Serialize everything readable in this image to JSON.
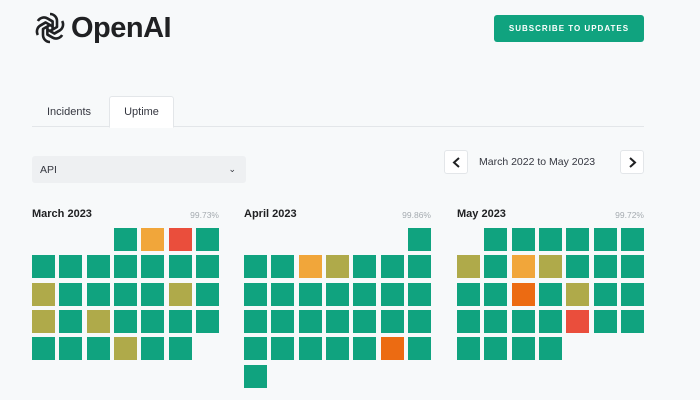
{
  "brand": {
    "name": "OpenAI"
  },
  "header": {
    "subscribe_label": "SUBSCRIBE TO UPDATES"
  },
  "tabs": [
    {
      "label": "Incidents",
      "active": false
    },
    {
      "label": "Uptime",
      "active": true
    }
  ],
  "component_select": {
    "value": "API"
  },
  "date_range": {
    "label": "March 2022 to May 2023"
  },
  "colors": {
    "ok": "#10a37f",
    "minor": "#afaa4a",
    "partial": "#f1a63a",
    "major": "#ec6b12",
    "outage": "#ea4e3c"
  },
  "months": [
    {
      "name": "March 2023",
      "uptime": "99.73%",
      "first_weekday": 3,
      "days": [
        "ok",
        "partial",
        "outage",
        "ok",
        "ok",
        "ok",
        "ok",
        "ok",
        "ok",
        "ok",
        "ok",
        "minor",
        "ok",
        "ok",
        "ok",
        "ok",
        "minor",
        "ok",
        "minor",
        "ok",
        "minor",
        "ok",
        "ok",
        "ok",
        "ok",
        "ok",
        "ok",
        "ok",
        "minor",
        "ok",
        "ok"
      ]
    },
    {
      "name": "April 2023",
      "uptime": "99.86%",
      "first_weekday": 6,
      "days": [
        "ok",
        "ok",
        "ok",
        "partial",
        "minor",
        "ok",
        "ok",
        "ok",
        "ok",
        "ok",
        "ok",
        "ok",
        "ok",
        "ok",
        "ok",
        "ok",
        "ok",
        "ok",
        "ok",
        "ok",
        "ok",
        "ok",
        "ok",
        "ok",
        "ok",
        "ok",
        "ok",
        "major",
        "ok",
        "ok"
      ]
    },
    {
      "name": "May 2023",
      "uptime": "99.72%",
      "first_weekday": 1,
      "days": [
        "ok",
        "ok",
        "ok",
        "ok",
        "ok",
        "ok",
        "minor",
        "ok",
        "partial",
        "minor",
        "ok",
        "ok",
        "ok",
        "ok",
        "ok",
        "major",
        "ok",
        "minor",
        "ok",
        "ok",
        "ok",
        "ok",
        "ok",
        "ok",
        "outage",
        "ok",
        "ok",
        "ok",
        "ok",
        "ok",
        "ok"
      ]
    }
  ]
}
